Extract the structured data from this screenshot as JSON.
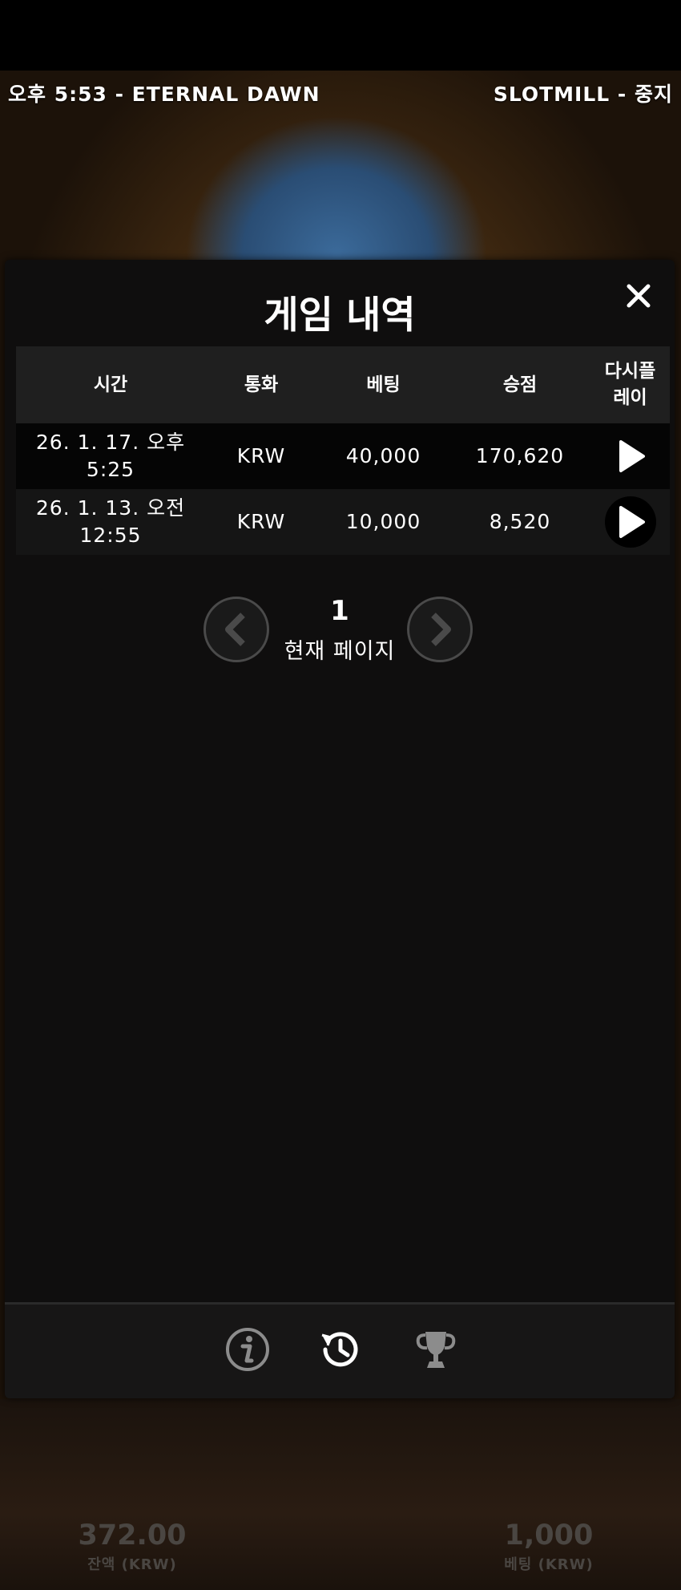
{
  "topbar": {
    "left": "오후 5:53 - ETERNAL DAWN",
    "right": "SLOTMILL - 중지"
  },
  "modal": {
    "title": "게임 내역",
    "columns": [
      "시간",
      "통화",
      "베팅",
      "승점",
      "다시플\n레이"
    ],
    "rows": [
      {
        "time": "26. 1. 17. 오후\n5:25",
        "currency": "KRW",
        "bet": "40,000",
        "win": "170,620"
      },
      {
        "time": "26. 1. 13. 오전\n12:55",
        "currency": "KRW",
        "bet": "10,000",
        "win": "8,520"
      }
    ],
    "pager": {
      "page": "1",
      "label": "현재 페이지"
    }
  },
  "footer_icons": [
    "info-icon",
    "history-icon",
    "trophy-icon"
  ],
  "bottom": {
    "balance_value": "372.00",
    "balance_label": "잔액 (KRW)",
    "bet_value": "1,000",
    "bet_label": "베팅 (KRW)"
  }
}
